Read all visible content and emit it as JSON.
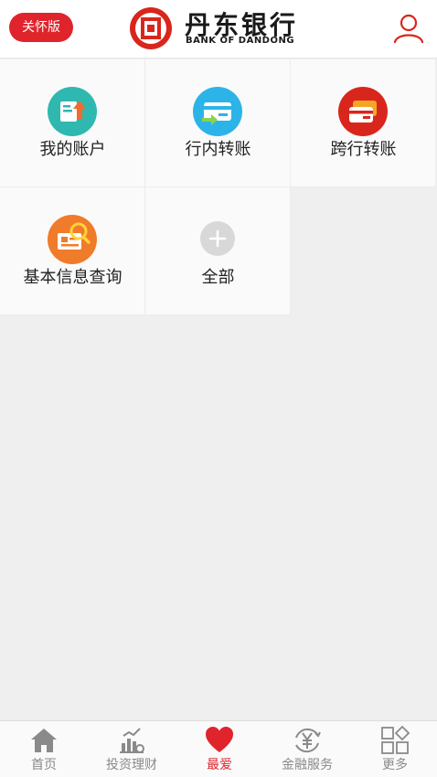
{
  "header": {
    "care_mode_label": "关怀版",
    "bank_name_cn": "丹东银行",
    "bank_name_en": "BANK OF DANDONG"
  },
  "tiles": [
    {
      "label": "我的账户",
      "icon": "account-icon",
      "color": "#2fb8b0"
    },
    {
      "label": "行内转账",
      "icon": "internal-transfer-icon",
      "color": "#2cb4e8"
    },
    {
      "label": "跨行转账",
      "icon": "interbank-transfer-icon",
      "color": "#d9261c"
    },
    {
      "label": "基本信息查询",
      "icon": "info-query-icon",
      "color": "#f07b2a"
    },
    {
      "label": "全部",
      "icon": "add-icon",
      "color": "#d8d8d8"
    }
  ],
  "tabbar": {
    "items": [
      {
        "label": "首页",
        "icon": "home-icon"
      },
      {
        "label": "投资理财",
        "icon": "investment-icon"
      },
      {
        "label": "最爱",
        "icon": "heart-icon",
        "active": true
      },
      {
        "label": "金融服务",
        "icon": "yuan-icon"
      },
      {
        "label": "更多",
        "icon": "more-grid-icon"
      }
    ]
  },
  "colors": {
    "accent": "#e0242c",
    "background": "#efefef",
    "tab_inactive": "#8a8a8a"
  }
}
